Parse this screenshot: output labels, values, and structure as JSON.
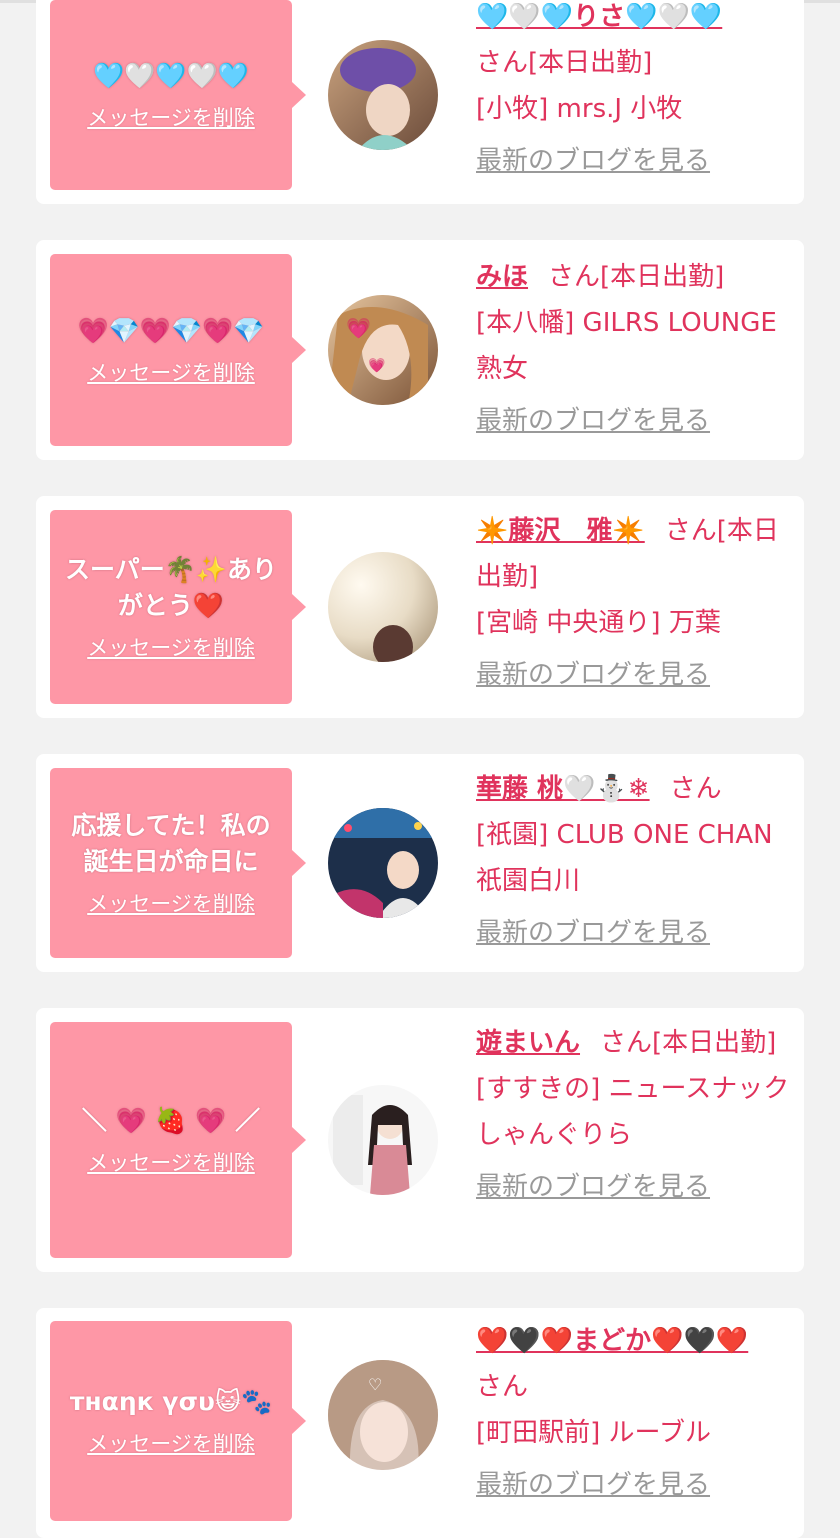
{
  "labels": {
    "delete": "メッセージを削除",
    "blog": "最新のブログを見る"
  },
  "colors": {
    "bubble": "#fe97a6",
    "accent": "#e0335c",
    "link_gray": "#999999",
    "background": "#f2f2f2"
  },
  "cards": [
    {
      "message": "🩵🤍🩵🤍🩵",
      "name": "🩵🤍🩵りさ🩵🤍🩵",
      "suffix": "さん[本日出勤]",
      "shop": "[小牧] mrs.J 小牧"
    },
    {
      "message": "💗💎💗💎💗💎",
      "name": "みほ",
      "suffix": "さん[本日出勤]",
      "shop": "[本八幡] GILRS LOUNGE 熟女"
    },
    {
      "message": "スーパー🌴✨ありがとう❤️",
      "name": "✴️藤沢　雅✴️",
      "suffix": "さん[本日出勤]",
      "shop": "[宮崎 中央通り] 万葉"
    },
    {
      "message": "応援してた！私の誕生日が命日に",
      "name": "華藤 桃🤍⛄❄",
      "suffix": "さん",
      "shop": "[祇園] CLUB ONE CHAN 祇園白川"
    },
    {
      "message": "＼ 💗 🍓 💗 ／",
      "name": "遊まいん",
      "suffix": "さん[本日出勤]",
      "shop": "[すすきの] ニュースナックしゃんぐりら"
    },
    {
      "message": "тнαηк үσυ😺🐾",
      "name": "❤️🖤❤️まどか❤️🖤❤️",
      "suffix": "さん",
      "shop": "[町田駅前] ルーブル"
    }
  ]
}
